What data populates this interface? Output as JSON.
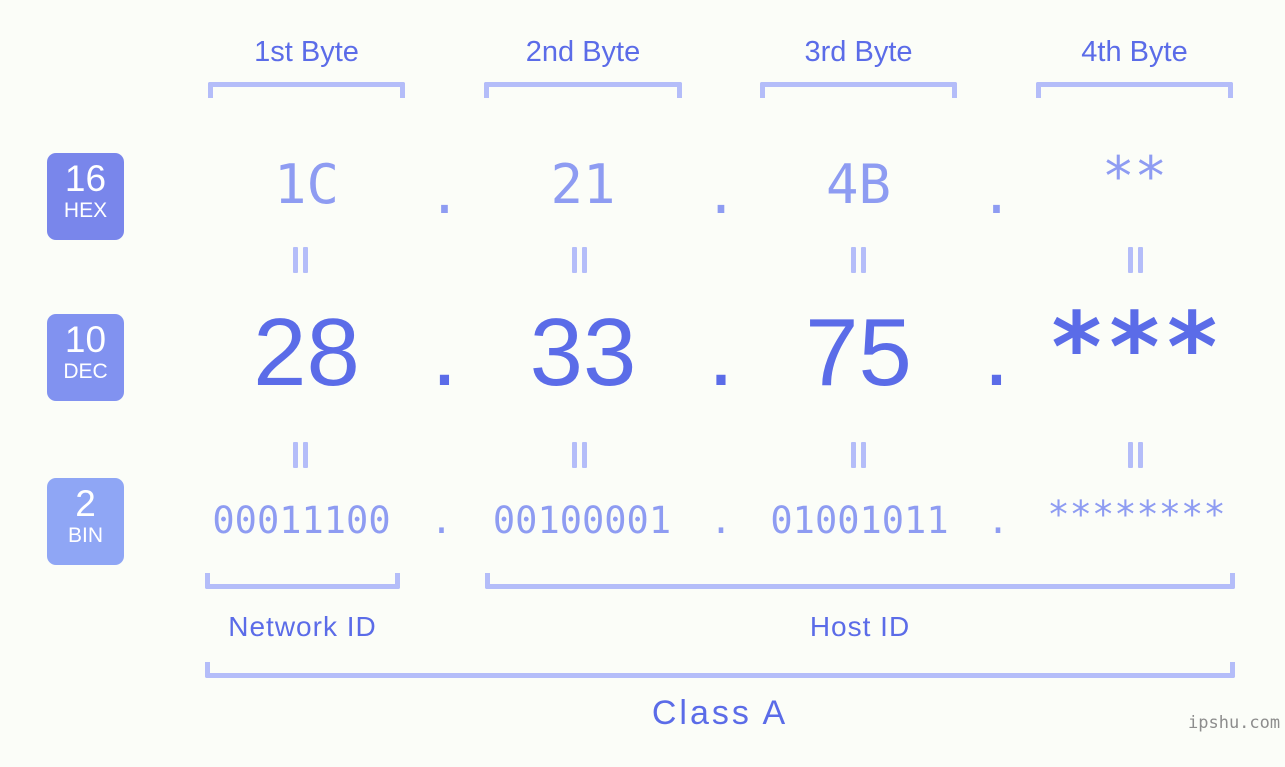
{
  "background_color": "#fbfdf8",
  "accent_colors": {
    "strong_blue": "#5b6ce8",
    "mid_blue": "#8e9cf2",
    "light_blue": "#b4bdf9",
    "badge_hex": "#7986eb",
    "badge_dec": "#8192f0",
    "badge_bin": "#8fa6f5",
    "watermark_gray": "#8d8d8d"
  },
  "byte_headers": [
    {
      "label": "1st Byte"
    },
    {
      "label": "2nd Byte"
    },
    {
      "label": "3rd Byte"
    },
    {
      "label": "4th Byte"
    }
  ],
  "bases": [
    {
      "number": "16",
      "name": "HEX"
    },
    {
      "number": "10",
      "name": "DEC"
    },
    {
      "number": "2",
      "name": "BIN"
    }
  ],
  "rows": {
    "hex": {
      "base_number": "16",
      "base_name": "HEX",
      "values": [
        "1C",
        "21",
        "4B",
        "**"
      ],
      "separator": "."
    },
    "dec": {
      "base_number": "10",
      "base_name": "DEC",
      "values": [
        "28",
        "33",
        "75",
        "***"
      ],
      "separator": "."
    },
    "bin": {
      "base_number": "2",
      "base_name": "BIN",
      "values": [
        "00011100",
        "00100001",
        "01001011",
        "********"
      ],
      "separator": "."
    }
  },
  "equality_separators": {
    "glyph": "=",
    "count_per_row": 4,
    "rows": 2
  },
  "sections": [
    {
      "label": "Network ID"
    },
    {
      "label": "Host ID"
    }
  ],
  "class": {
    "label": "Class A"
  },
  "watermark": {
    "text": "ipshu.com"
  }
}
